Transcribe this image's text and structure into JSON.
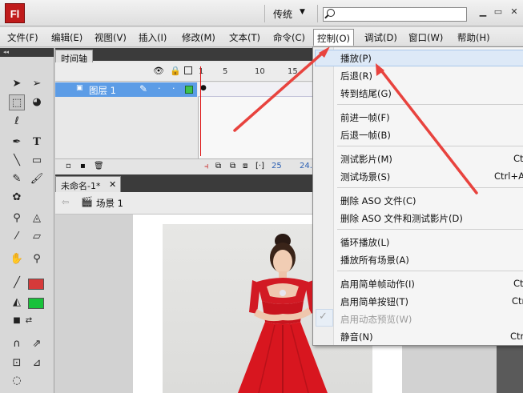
{
  "titlebar": {
    "logo": "Fl",
    "workspace": "传统",
    "search": {
      "value": "",
      "placeholder": ""
    }
  },
  "menubar": {
    "items": [
      "文件(F)",
      "编辑(E)",
      "视图(V)",
      "插入(I)",
      "修改(M)",
      "文本(T)",
      "命令(C)",
      "控制(O)",
      "调试(D)",
      "窗口(W)",
      "帮助(H)"
    ],
    "active": "控制(O)"
  },
  "timeline": {
    "tab": "时间轴",
    "layer": "图层 1",
    "frame_numbers": [
      "1",
      "5",
      "10",
      "15"
    ],
    "footer_frame": "25",
    "footer_fps": "24.0"
  },
  "document": {
    "tab": "未命名-1*",
    "scene": "场景 1"
  },
  "colors": {
    "stroke": "#d63a3a",
    "fill": "#18c23a",
    "highlight": "#dde9f7",
    "layer_selected": "#5c9ce6",
    "arrow": "#e8433e"
  },
  "control_menu": {
    "groups": [
      [
        {
          "label": "播放(P)",
          "shortcut": "",
          "highlighted": true
        },
        {
          "label": "后退(R)",
          "shortcut": ""
        },
        {
          "label": "转到结尾(G)",
          "shortcut": ""
        }
      ],
      [
        {
          "label": "前进一帧(F)",
          "shortcut": ""
        },
        {
          "label": "后退一帧(B)",
          "shortcut": ""
        }
      ],
      [
        {
          "label": "测试影片(M)",
          "shortcut": "Ct"
        },
        {
          "label": "测试场景(S)",
          "shortcut": "Ctrl+A"
        }
      ],
      [
        {
          "label": "删除 ASO 文件(C)",
          "shortcut": ""
        },
        {
          "label": "删除 ASO 文件和测试影片(D)",
          "shortcut": ""
        }
      ],
      [
        {
          "label": "循环播放(L)",
          "shortcut": ""
        },
        {
          "label": "播放所有场景(A)",
          "shortcut": ""
        }
      ],
      [
        {
          "label": "启用简单帧动作(I)",
          "shortcut": "Ct"
        },
        {
          "label": "启用简单按钮(T)",
          "shortcut": "Ctr"
        },
        {
          "label": "启用动态预览(W)",
          "shortcut": "",
          "checked": true,
          "disabled": true
        },
        {
          "label": "静音(N)",
          "shortcut": "Ctr"
        }
      ]
    ]
  }
}
